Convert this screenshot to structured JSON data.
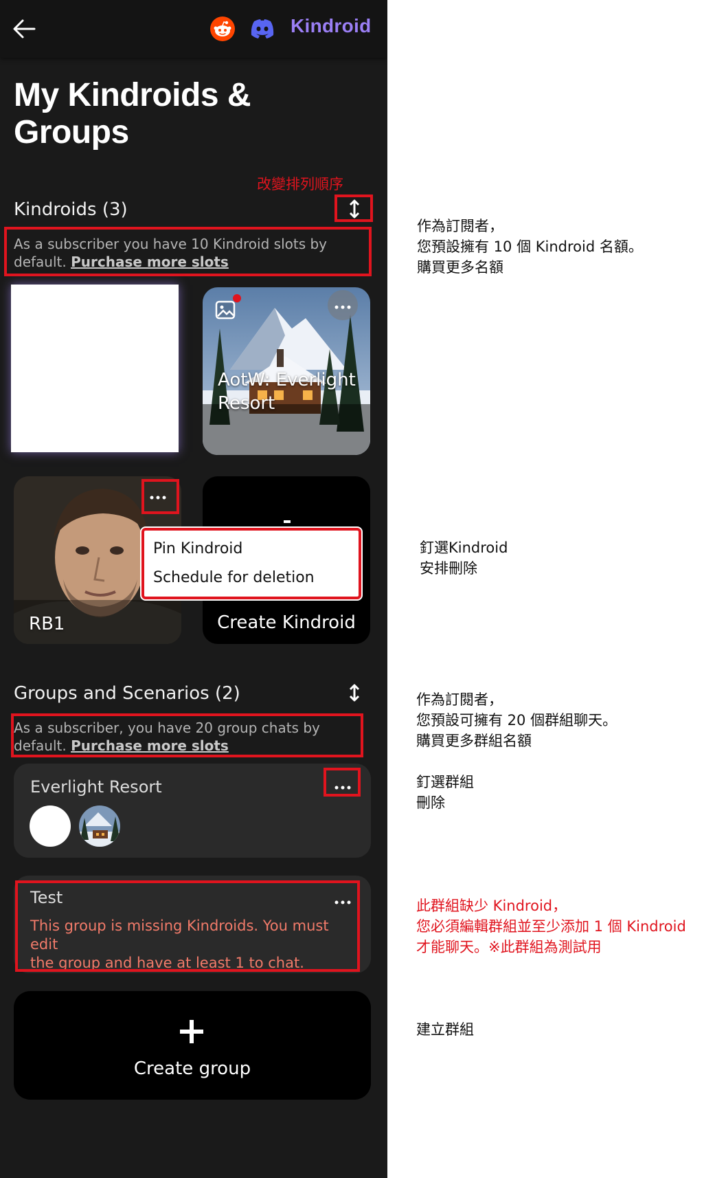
{
  "app": {
    "brand": "Kindroid",
    "title_line1": "My Kindroids &",
    "title_line2": "Groups"
  },
  "icons": {
    "back": "arrow-left-icon",
    "reddit": "reddit-icon",
    "discord": "discord-icon",
    "sort": "sort-vertical-icon",
    "more": "more-horizontal-icon",
    "image": "image-icon",
    "plus": "plus-icon"
  },
  "colors": {
    "background": "#1a1a1a",
    "brand": "#9b7ff5",
    "highlight": "#e0141e",
    "warning_text": "#f27b6a"
  },
  "kindroids": {
    "heading": "Kindroids (3)",
    "note": "As a subscriber you have 10 Kindroid slots by default.",
    "purchase_link": "Purchase more slots",
    "cards": [
      {
        "label": "",
        "image": "hidden-avatar"
      },
      {
        "label_line1": "AotW: Everlight",
        "label_line2": "Resort",
        "image": "snowy-cabin-photo",
        "has_new_indicator": true
      },
      {
        "label": "RB1",
        "image": "man-portrait-photo"
      },
      {
        "label": "Create Kindroid"
      }
    ],
    "menu": {
      "pin": "Pin Kindroid",
      "schedule_delete": "Schedule for deletion"
    }
  },
  "groups": {
    "heading": "Groups and Scenarios (2)",
    "note": "As a subscriber, you have 20 group chats by default.",
    "purchase_link": "Purchase more slots",
    "items": [
      {
        "name": "Everlight Resort",
        "member_avatars": [
          "white-avatar",
          "snowy-cabin-avatar"
        ]
      },
      {
        "name": "Test",
        "warning_line1": "This group is missing Kindroids. You must edit",
        "warning_line2": "the group and have at least 1 to chat."
      }
    ],
    "create_label": "Create group"
  },
  "annotations": {
    "sort_order": "改變排列順序",
    "kindroid_slots": [
      "作為訂閱者，",
      "您預設擁有 10 個 Kindroid 名額。",
      "購買更多名額"
    ],
    "kindroid_menu": [
      "釘選Kindroid",
      "安排刪除"
    ],
    "group_slots": [
      "作為訂閱者，",
      "您預設可擁有 20 個群組聊天。",
      "購買更多群組名額"
    ],
    "group_menu": [
      "釘選群組",
      "刪除"
    ],
    "missing_kindroids": [
      "此群組缺少 Kindroid，",
      "您必須編輯群組並至少添加 1 個 Kindroid",
      "才能聊天。※此群組為測試用"
    ],
    "create_group": "建立群組"
  }
}
